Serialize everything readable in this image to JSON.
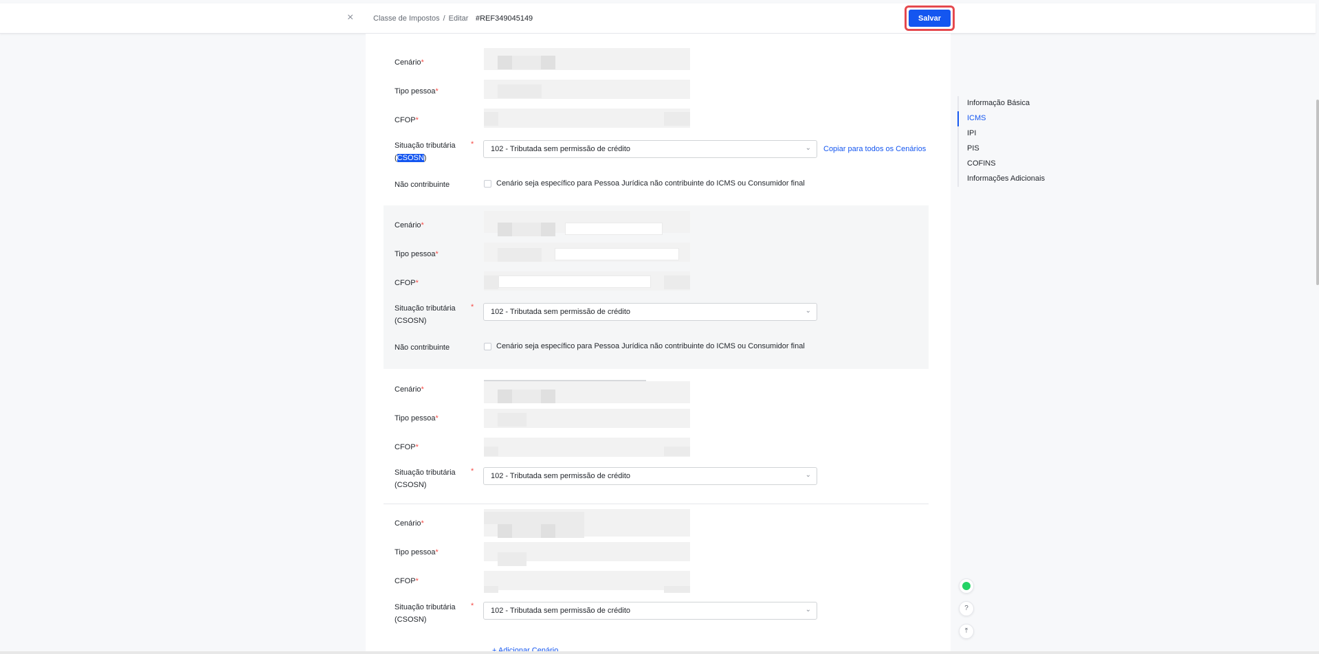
{
  "header": {
    "close_icon": "×",
    "breadcrumb_root": "Classe de Impostos",
    "breadcrumb_sep": "/",
    "breadcrumb_current": "Editar",
    "reference": "#REF349045149",
    "save_label": "Salvar"
  },
  "labels": {
    "scenario": "Cenário",
    "person_type": "Tipo pessoa",
    "cfop": "CFOP",
    "tax_status_line1": "Situação tributária",
    "tax_status_line2": "(CSOSN)",
    "tax_status_paren_open": "(",
    "tax_status_hl": "CSOSN",
    "tax_status_paren_close": ")",
    "non_contributor": "Não contribuinte",
    "required": "*"
  },
  "scenarios": [
    {
      "tax_status_value": "102 - Tributada sem permissão de crédito",
      "non_contributor_text": "Cenário seja específico para Pessoa Jurídica não contribuinte do ICMS ou Consumidor final",
      "copy_link": "Copiar para todos os Cenários"
    },
    {
      "tax_status_value": "102 - Tributada sem permissão de crédito",
      "non_contributor_text": "Cenário seja específico para Pessoa Jurídica não contribuinte do ICMS ou Consumidor final"
    },
    {
      "tax_status_value": "102 - Tributada sem permissão de crédito"
    },
    {
      "tax_status_value": "102 - Tributada sem permissão de crédito"
    }
  ],
  "add_scenario": "+ Adicionar Cenário",
  "anchor_nav": {
    "items": [
      "Informação Básica",
      "ICMS",
      "IPI",
      "PIS",
      "COFINS",
      "Informações Adicionais"
    ],
    "active_index": 1
  },
  "icons": {
    "chevron": "⌄",
    "whatsapp": "whatsapp-icon",
    "help": "?",
    "back_to_top": "⤒"
  }
}
